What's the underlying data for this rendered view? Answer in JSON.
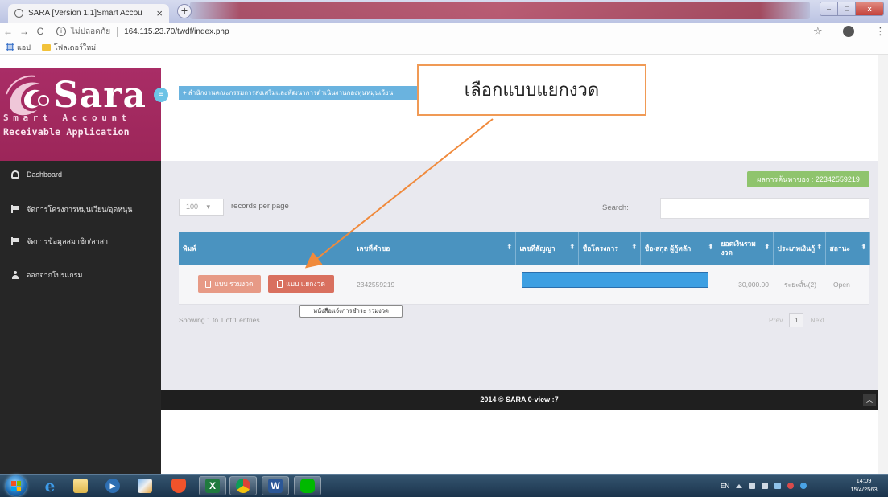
{
  "browser": {
    "tab": {
      "title": "SARA [Version 1.1]Smart Accou",
      "icon": "globe-icon",
      "close_glyph": "×"
    },
    "new_tab_glyph": "+",
    "window_controls": {
      "minimize": "–",
      "maximize": "□",
      "close": "x"
    },
    "nav": {
      "back": "←",
      "forward": "→",
      "reload": "C",
      "info": "i"
    },
    "address": {
      "security_label": "ไม่ปลอดภัย",
      "url": "164.115.23.70/twdf/index.php"
    },
    "right": {
      "star": "☆",
      "menu": "⋮"
    },
    "bookmarks": [
      {
        "label": "แอป",
        "icon": "apps-grid-icon"
      },
      {
        "label": "โฟลเดอร์ใหม่",
        "icon": "folder-icon"
      }
    ]
  },
  "sidebar": {
    "logo": {
      "name": "Sara",
      "line1": "Smart Account",
      "line2": "Receivable Application",
      "icon": "sara-swirl-icon"
    },
    "toggle_glyph": "≡",
    "items": [
      {
        "label": "Dashboard",
        "icon": "dashboard-icon"
      },
      {
        "label": "จัดการโครงการหมุนเวียน/อุดหนุน",
        "icon": "flag-icon"
      },
      {
        "label": "จัดการข้อมูลสมาชิก/ลาสา",
        "icon": "flag-icon"
      },
      {
        "label": "ออกจากโปรแกรม",
        "icon": "user-icon"
      }
    ]
  },
  "header": {
    "org_label": "+ สำนักงานคณะกรรมการส่งเสริมและพัฒนาการดำเนินงานกองทุนหมุนเวียน"
  },
  "annotation": {
    "callout": "เลือกแบบแยกงวด"
  },
  "main": {
    "result_badge": "ผลการค้นหาของ : 22342559219",
    "length_value": "100",
    "length_caret": "▾",
    "length_label": "records per page",
    "search_label": "Search:",
    "sort_glyph": "⬍",
    "table": {
      "headers": [
        "พิมพ์",
        "เลขที่คำขอ",
        "เลขที่สัญญา",
        "ชื่อโครงการ",
        "ชื่อ-สกุล ผู้กู้หลัก",
        "ยอดเงินรวม งวด",
        "ประเภทเงินกู้",
        "สถานะ"
      ],
      "rows": [
        {
          "print_buttons": [
            {
              "label": "แบบ รวมงวด",
              "icon": "document-icon"
            },
            {
              "label": "แบบ แยกงวด",
              "icon": "copy-icon"
            }
          ],
          "request_no": "2342559219",
          "total_amount": "30,000.00",
          "loan_type": "ระยะสั้น(2)",
          "status": "Open"
        }
      ]
    },
    "tooltip": "หนังสือแจ้งการชำระ รวมงวด",
    "info": "Showing 1 to 1 of 1 entries",
    "pagination": {
      "prev": "Prev",
      "current": "1",
      "next": "Next"
    }
  },
  "footer": {
    "text": "2014 © SARA 0-view :7",
    "up_glyph": "︿"
  },
  "taskbar": {
    "apps": [
      {
        "icon": "internet-explorer-icon",
        "glyph": "e"
      },
      {
        "icon": "file-explorer-icon",
        "glyph": ""
      },
      {
        "icon": "media-player-icon",
        "glyph": "▶"
      },
      {
        "icon": "paint-icon",
        "glyph": ""
      },
      {
        "icon": "brave-browser-icon",
        "glyph": ""
      },
      {
        "icon": "excel-icon",
        "glyph": "X"
      },
      {
        "icon": "chrome-icon",
        "glyph": ""
      },
      {
        "icon": "word-icon",
        "glyph": "W"
      },
      {
        "icon": "line-app-icon",
        "glyph": ""
      }
    ],
    "lang": "EN",
    "time": "14:09",
    "date": "15/4/2563"
  },
  "colors": {
    "brand_magenta": "#a92d66",
    "sidebar_dark": "#262626",
    "table_header_blue": "#4a93c0",
    "button_combined": "#e79a86",
    "button_split": "#d9705f",
    "badge_green": "#8fc46d",
    "callout_border": "#f09a55",
    "redaction_blue": "#3d9fe2"
  }
}
